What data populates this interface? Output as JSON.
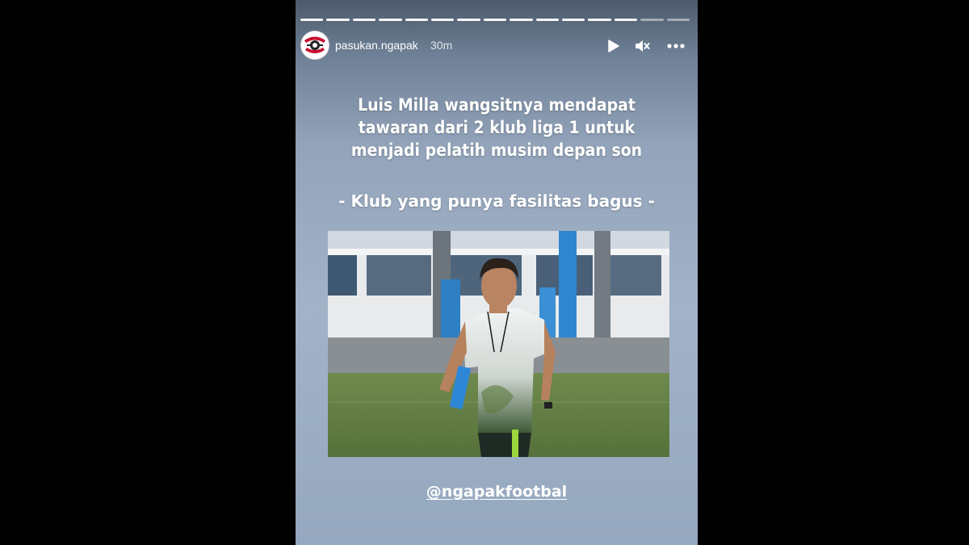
{
  "story": {
    "username": "pasukan.ngapak",
    "time_ago": "30m",
    "progress": {
      "segments": 15,
      "watched": 13
    },
    "controls": {
      "play_icon": "play-icon",
      "mute_icon": "muted-speaker-icon",
      "more_icon": "more-horizontal-icon"
    },
    "headline_lines": [
      "Luis Milla wangsitnya mendapat",
      "tawaran dari 2 klub liga 1 untuk",
      "menjadi pelatih musim depan son"
    ],
    "subline": "- Klub yang punya fasilitas bagus -",
    "photo_alt": "Pelatih sepak bola di lapangan latihan",
    "mention": "@ngapakfootbal"
  },
  "colors": {
    "page_background": "#000000",
    "story_top": "#4c5a6b",
    "story_mid": "#a2b3c8",
    "text": "#ffffff"
  }
}
